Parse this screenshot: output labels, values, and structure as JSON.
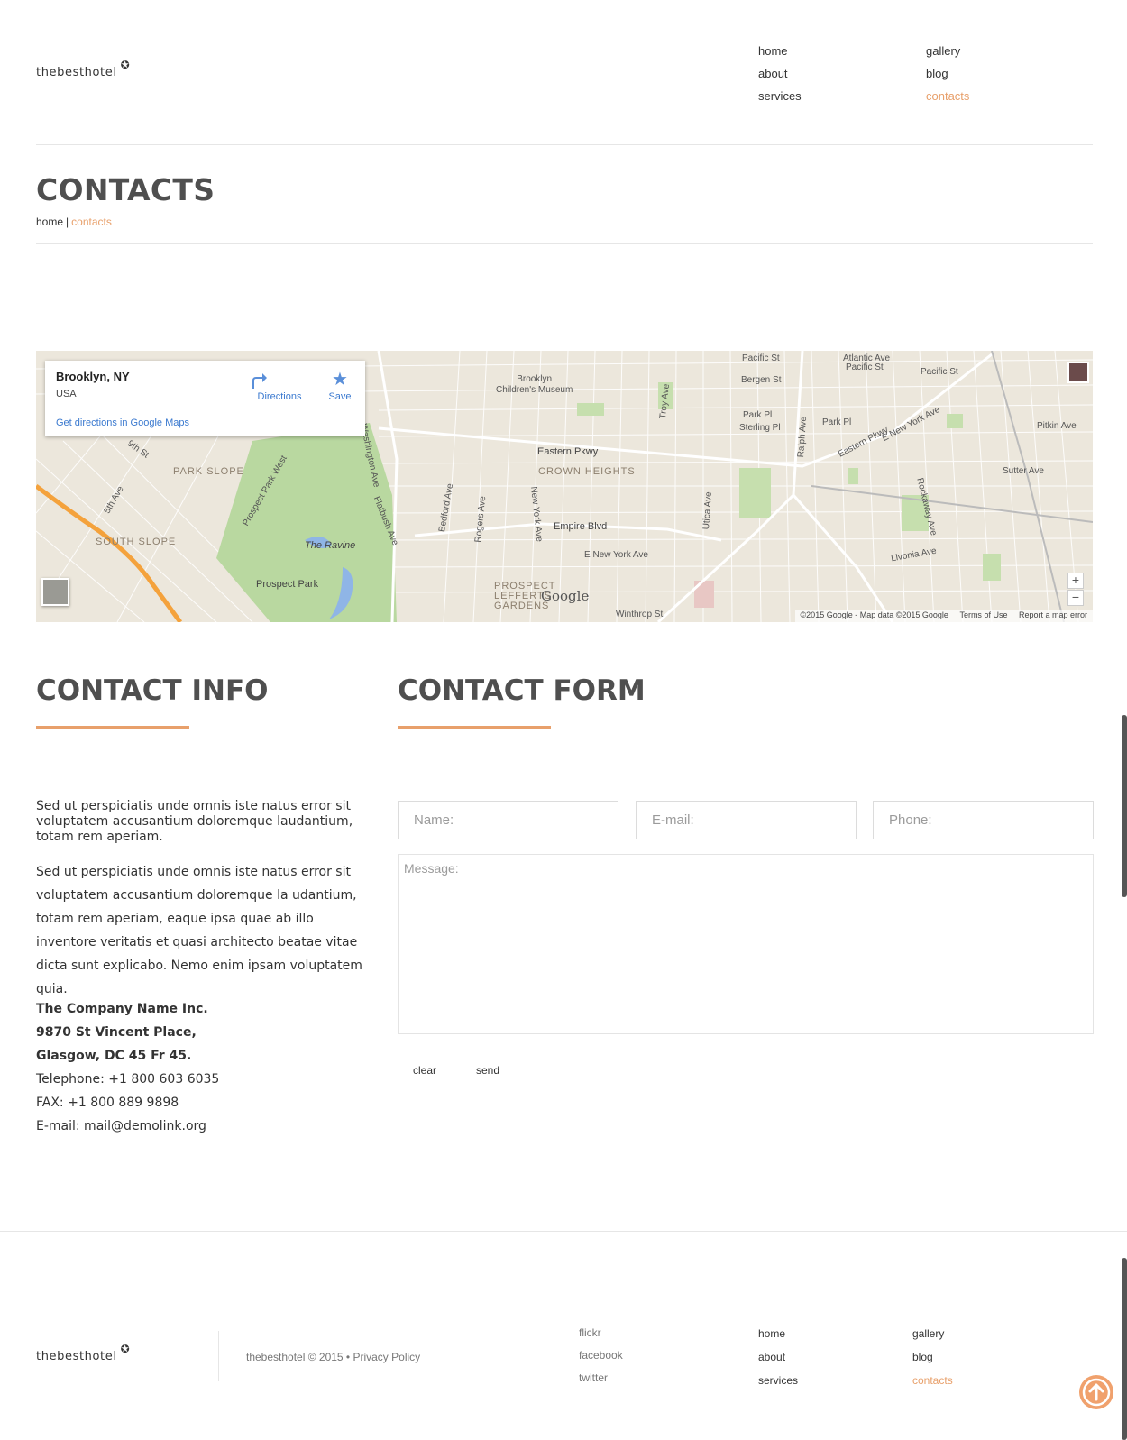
{
  "header": {
    "logo_text": "thebesthotel",
    "logo_mark": "✪",
    "nav_col1": [
      "home",
      "about",
      "services"
    ],
    "nav_col2": [
      "gallery",
      "blog",
      "contacts"
    ],
    "active_item": "contacts"
  },
  "page": {
    "title": "CONTACTS",
    "breadcrumb": {
      "home": "home",
      "separator": "|",
      "current": "contacts"
    }
  },
  "map": {
    "place_title": "Brooklyn, NY",
    "place_subtitle": "USA",
    "directions_label": "Directions",
    "save_label": "Save",
    "directions_link": "Get directions in Google Maps",
    "zoom_in": "+",
    "zoom_out": "−",
    "copyright": "©2015 Google - Map data ©2015 Google",
    "terms": "Terms of Use",
    "report": "Report a map error",
    "google_mark": "Google",
    "labels": {
      "atlantic_ave": "Atlantic Ave",
      "pacific_st_1": "Pacific St",
      "pacific_st_2": "Pacific St",
      "pacific_st_3": "Pacific St",
      "bergen_st": "Bergen St",
      "brooklyn_museum": "Brooklyn\nChildren's Museum",
      "park_pl_1": "Park Pl",
      "sterling_pl": "Sterling Pl",
      "park_pl_2": "Park Pl",
      "pitkin_ave": "Pitkin Ave",
      "eastern_pkwy": "Eastern Pkwy",
      "eastern_pkwy_2": "Eastern Pkwy",
      "e_new_york_ave": "E New York Ave",
      "sutter_ave": "Sutter Ave",
      "crown_heights": "CROWN HEIGHTS",
      "park_slope": "PARK SLOPE",
      "south_slope": "SOUTH SLOPE",
      "empire_blvd": "Empire Blvd",
      "the_ravine": "The Ravine",
      "prospect_park": "Prospect Park",
      "prospect_lefferts": "PROSPECT\nLEFFERTS\nGARDENS",
      "livonia_ave": "Livonia Ave",
      "e_new_york_ave_2": "E New York Ave",
      "winthrop_st": "Winthrop St",
      "washington_ave": "Washington Ave",
      "flatbush_ave": "Flatbush Ave",
      "bedford_ave": "Bedford Ave",
      "rogers_ave": "Rogers Ave",
      "new_york_ave": "New York Ave",
      "troy_ave": "Troy Ave",
      "utica_ave": "Utica Ave",
      "ralph_ave": "Ralph Ave",
      "rockaway_ave": "Rockaway Ave",
      "ninth_st": "9th St",
      "fifth_ave": "5th Ave",
      "prospect_park_west": "Prospect Park West"
    }
  },
  "contact_info": {
    "title": "CONTACT INFO",
    "para1": "Sed ut perspiciatis unde omnis iste natus error sit voluptatem accusantium doloremque laudantium, totam rem aperiam.",
    "para2": "Sed ut perspiciatis unde omnis iste natus error sit voluptatem accusantium doloremque la udantium, totam rem aperiam, eaque ipsa quae ab illo inventore veritatis et quasi architecto beatae vitae dicta sunt explicabo. Nemo enim ipsam voluptatem quia.",
    "company": "The Company Name Inc.",
    "address1": "9870 St Vincent Place,",
    "address2": "Glasgow, DC 45 Fr 45.",
    "telephone": "Telephone: +1 800 603 6035",
    "fax": "FAX: +1 800 889 9898",
    "email": "E-mail: mail@demolink.org"
  },
  "contact_form": {
    "title": "CONTACT FORM",
    "name_placeholder": "Name:",
    "email_placeholder": "E-mail:",
    "phone_placeholder": "Phone:",
    "message_placeholder": "Message:",
    "clear_label": "clear",
    "send_label": "send"
  },
  "footer": {
    "logo_text": "thebesthotel",
    "logo_mark": "✪",
    "copyright": "thebesthotel © 2015 •",
    "privacy": "Privacy Policy",
    "social": [
      "flickr",
      "facebook",
      "twitter"
    ],
    "nav_col1": [
      "home",
      "about",
      "services"
    ],
    "nav_col2": [
      "gallery",
      "blog",
      "contacts"
    ],
    "to_top_icon": "arrow-up-circle-icon"
  },
  "colors": {
    "accent": "#e8a06b",
    "heading": "#4f4f4f",
    "map_bg": "#ece7dc",
    "park_green": "#b9d8a0",
    "water": "#8fb5e6",
    "highway": "#f4a23c"
  }
}
